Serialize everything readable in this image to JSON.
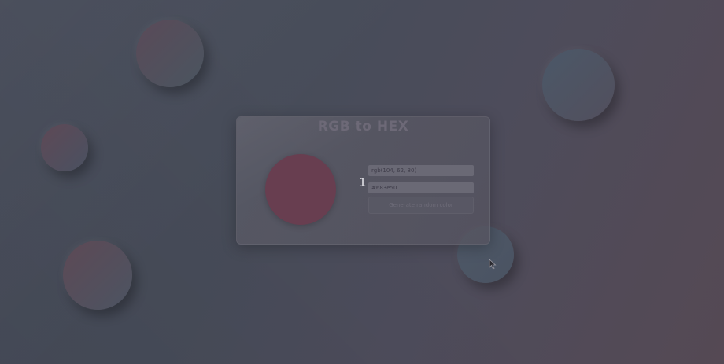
{
  "app": {
    "title": "RGB to HEX",
    "counter": "1"
  },
  "inputs": {
    "rgb_value": "rgb(104, 62, 80)",
    "hex_value": "#683e50"
  },
  "buttons": {
    "generate_label": "Generate random color"
  },
  "swatch": {
    "color": "#683e50"
  },
  "icons": {
    "cursor": "mouse-pointer-icon"
  }
}
